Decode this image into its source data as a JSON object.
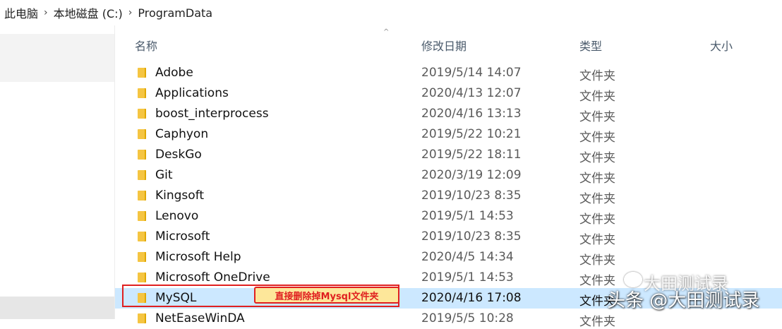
{
  "breadcrumb": [
    "此电脑",
    "本地磁盘 (C:)",
    "ProgramData"
  ],
  "columns": {
    "name": "名称",
    "date": "修改日期",
    "type": "类型",
    "size": "大小"
  },
  "rows": [
    {
      "name": "Adobe",
      "date": "2019/5/14 14:07",
      "type": "文件夹"
    },
    {
      "name": "Applications",
      "date": "2020/4/13 12:07",
      "type": "文件夹"
    },
    {
      "name": "boost_interprocess",
      "date": "2020/4/16 13:13",
      "type": "文件夹"
    },
    {
      "name": "Caphyon",
      "date": "2019/5/22 10:21",
      "type": "文件夹"
    },
    {
      "name": "DeskGo",
      "date": "2019/5/22 18:11",
      "type": "文件夹"
    },
    {
      "name": "Git",
      "date": "2020/3/19 12:09",
      "type": "文件夹"
    },
    {
      "name": "Kingsoft",
      "date": "2019/10/23 8:35",
      "type": "文件夹"
    },
    {
      "name": "Lenovo",
      "date": "2019/5/1 14:53",
      "type": "文件夹"
    },
    {
      "name": "Microsoft",
      "date": "2019/10/23 8:35",
      "type": "文件夹"
    },
    {
      "name": "Microsoft Help",
      "date": "2020/4/5 14:34",
      "type": "文件夹"
    },
    {
      "name": "Microsoft OneDrive",
      "date": "2019/5/1 14:53",
      "type": "文件夹"
    },
    {
      "name": "MySQL",
      "date": "2020/4/16 17:08",
      "type": "文件夹",
      "selected": true
    },
    {
      "name": "NetEaseWinDA",
      "date": "2019/5/5 10:28",
      "type": "文件夹"
    }
  ],
  "callout": "直接删除掉Mysql文件夹",
  "watermark": "头条 @大田测试录",
  "watermark_top": "大田测试录",
  "colors": {
    "selected_row": "#cce8ff",
    "highlight_border": "#e02020",
    "callout_bg": "#fde79a",
    "folder": "#f5c542"
  }
}
